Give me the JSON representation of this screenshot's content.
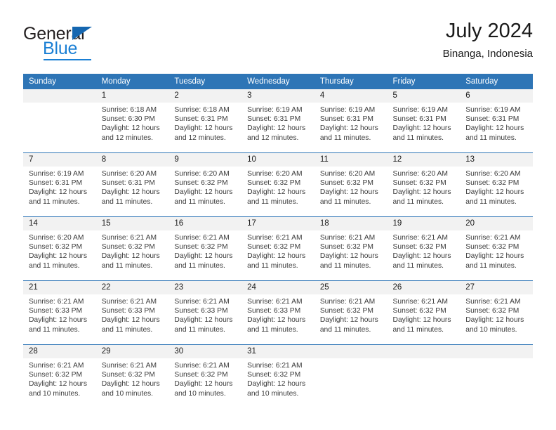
{
  "brand": {
    "name_part1": "General",
    "name_part2": "Blue",
    "accent_color": "#1a7fd4",
    "triangle_color": "#1566b0"
  },
  "header": {
    "title": "July 2024",
    "subtitle": "Binanga, Indonesia"
  },
  "theme": {
    "header_blue": "#2e75b6",
    "daynum_band": "#f2f2f2",
    "text": "#3b3b3b"
  },
  "calendar": {
    "weekday_headers": [
      "Sunday",
      "Monday",
      "Tuesday",
      "Wednesday",
      "Thursday",
      "Friday",
      "Saturday"
    ],
    "weeks": [
      [
        {
          "day": "",
          "sunrise": "",
          "sunset": "",
          "daylight_line1": "",
          "daylight_line2": ""
        },
        {
          "day": "1",
          "sunrise": "Sunrise: 6:18 AM",
          "sunset": "Sunset: 6:30 PM",
          "daylight_line1": "Daylight: 12 hours",
          "daylight_line2": "and 12 minutes."
        },
        {
          "day": "2",
          "sunrise": "Sunrise: 6:18 AM",
          "sunset": "Sunset: 6:31 PM",
          "daylight_line1": "Daylight: 12 hours",
          "daylight_line2": "and 12 minutes."
        },
        {
          "day": "3",
          "sunrise": "Sunrise: 6:19 AM",
          "sunset": "Sunset: 6:31 PM",
          "daylight_line1": "Daylight: 12 hours",
          "daylight_line2": "and 12 minutes."
        },
        {
          "day": "4",
          "sunrise": "Sunrise: 6:19 AM",
          "sunset": "Sunset: 6:31 PM",
          "daylight_line1": "Daylight: 12 hours",
          "daylight_line2": "and 11 minutes."
        },
        {
          "day": "5",
          "sunrise": "Sunrise: 6:19 AM",
          "sunset": "Sunset: 6:31 PM",
          "daylight_line1": "Daylight: 12 hours",
          "daylight_line2": "and 11 minutes."
        },
        {
          "day": "6",
          "sunrise": "Sunrise: 6:19 AM",
          "sunset": "Sunset: 6:31 PM",
          "daylight_line1": "Daylight: 12 hours",
          "daylight_line2": "and 11 minutes."
        }
      ],
      [
        {
          "day": "7",
          "sunrise": "Sunrise: 6:19 AM",
          "sunset": "Sunset: 6:31 PM",
          "daylight_line1": "Daylight: 12 hours",
          "daylight_line2": "and 11 minutes."
        },
        {
          "day": "8",
          "sunrise": "Sunrise: 6:20 AM",
          "sunset": "Sunset: 6:31 PM",
          "daylight_line1": "Daylight: 12 hours",
          "daylight_line2": "and 11 minutes."
        },
        {
          "day": "9",
          "sunrise": "Sunrise: 6:20 AM",
          "sunset": "Sunset: 6:32 PM",
          "daylight_line1": "Daylight: 12 hours",
          "daylight_line2": "and 11 minutes."
        },
        {
          "day": "10",
          "sunrise": "Sunrise: 6:20 AM",
          "sunset": "Sunset: 6:32 PM",
          "daylight_line1": "Daylight: 12 hours",
          "daylight_line2": "and 11 minutes."
        },
        {
          "day": "11",
          "sunrise": "Sunrise: 6:20 AM",
          "sunset": "Sunset: 6:32 PM",
          "daylight_line1": "Daylight: 12 hours",
          "daylight_line2": "and 11 minutes."
        },
        {
          "day": "12",
          "sunrise": "Sunrise: 6:20 AM",
          "sunset": "Sunset: 6:32 PM",
          "daylight_line1": "Daylight: 12 hours",
          "daylight_line2": "and 11 minutes."
        },
        {
          "day": "13",
          "sunrise": "Sunrise: 6:20 AM",
          "sunset": "Sunset: 6:32 PM",
          "daylight_line1": "Daylight: 12 hours",
          "daylight_line2": "and 11 minutes."
        }
      ],
      [
        {
          "day": "14",
          "sunrise": "Sunrise: 6:20 AM",
          "sunset": "Sunset: 6:32 PM",
          "daylight_line1": "Daylight: 12 hours",
          "daylight_line2": "and 11 minutes."
        },
        {
          "day": "15",
          "sunrise": "Sunrise: 6:21 AM",
          "sunset": "Sunset: 6:32 PM",
          "daylight_line1": "Daylight: 12 hours",
          "daylight_line2": "and 11 minutes."
        },
        {
          "day": "16",
          "sunrise": "Sunrise: 6:21 AM",
          "sunset": "Sunset: 6:32 PM",
          "daylight_line1": "Daylight: 12 hours",
          "daylight_line2": "and 11 minutes."
        },
        {
          "day": "17",
          "sunrise": "Sunrise: 6:21 AM",
          "sunset": "Sunset: 6:32 PM",
          "daylight_line1": "Daylight: 12 hours",
          "daylight_line2": "and 11 minutes."
        },
        {
          "day": "18",
          "sunrise": "Sunrise: 6:21 AM",
          "sunset": "Sunset: 6:32 PM",
          "daylight_line1": "Daylight: 12 hours",
          "daylight_line2": "and 11 minutes."
        },
        {
          "day": "19",
          "sunrise": "Sunrise: 6:21 AM",
          "sunset": "Sunset: 6:32 PM",
          "daylight_line1": "Daylight: 12 hours",
          "daylight_line2": "and 11 minutes."
        },
        {
          "day": "20",
          "sunrise": "Sunrise: 6:21 AM",
          "sunset": "Sunset: 6:32 PM",
          "daylight_line1": "Daylight: 12 hours",
          "daylight_line2": "and 11 minutes."
        }
      ],
      [
        {
          "day": "21",
          "sunrise": "Sunrise: 6:21 AM",
          "sunset": "Sunset: 6:33 PM",
          "daylight_line1": "Daylight: 12 hours",
          "daylight_line2": "and 11 minutes."
        },
        {
          "day": "22",
          "sunrise": "Sunrise: 6:21 AM",
          "sunset": "Sunset: 6:33 PM",
          "daylight_line1": "Daylight: 12 hours",
          "daylight_line2": "and 11 minutes."
        },
        {
          "day": "23",
          "sunrise": "Sunrise: 6:21 AM",
          "sunset": "Sunset: 6:33 PM",
          "daylight_line1": "Daylight: 12 hours",
          "daylight_line2": "and 11 minutes."
        },
        {
          "day": "24",
          "sunrise": "Sunrise: 6:21 AM",
          "sunset": "Sunset: 6:33 PM",
          "daylight_line1": "Daylight: 12 hours",
          "daylight_line2": "and 11 minutes."
        },
        {
          "day": "25",
          "sunrise": "Sunrise: 6:21 AM",
          "sunset": "Sunset: 6:32 PM",
          "daylight_line1": "Daylight: 12 hours",
          "daylight_line2": "and 11 minutes."
        },
        {
          "day": "26",
          "sunrise": "Sunrise: 6:21 AM",
          "sunset": "Sunset: 6:32 PM",
          "daylight_line1": "Daylight: 12 hours",
          "daylight_line2": "and 11 minutes."
        },
        {
          "day": "27",
          "sunrise": "Sunrise: 6:21 AM",
          "sunset": "Sunset: 6:32 PM",
          "daylight_line1": "Daylight: 12 hours",
          "daylight_line2": "and 10 minutes."
        }
      ],
      [
        {
          "day": "28",
          "sunrise": "Sunrise: 6:21 AM",
          "sunset": "Sunset: 6:32 PM",
          "daylight_line1": "Daylight: 12 hours",
          "daylight_line2": "and 10 minutes."
        },
        {
          "day": "29",
          "sunrise": "Sunrise: 6:21 AM",
          "sunset": "Sunset: 6:32 PM",
          "daylight_line1": "Daylight: 12 hours",
          "daylight_line2": "and 10 minutes."
        },
        {
          "day": "30",
          "sunrise": "Sunrise: 6:21 AM",
          "sunset": "Sunset: 6:32 PM",
          "daylight_line1": "Daylight: 12 hours",
          "daylight_line2": "and 10 minutes."
        },
        {
          "day": "31",
          "sunrise": "Sunrise: 6:21 AM",
          "sunset": "Sunset: 6:32 PM",
          "daylight_line1": "Daylight: 12 hours",
          "daylight_line2": "and 10 minutes."
        },
        {
          "day": "",
          "sunrise": "",
          "sunset": "",
          "daylight_line1": "",
          "daylight_line2": ""
        },
        {
          "day": "",
          "sunrise": "",
          "sunset": "",
          "daylight_line1": "",
          "daylight_line2": ""
        },
        {
          "day": "",
          "sunrise": "",
          "sunset": "",
          "daylight_line1": "",
          "daylight_line2": ""
        }
      ]
    ]
  }
}
